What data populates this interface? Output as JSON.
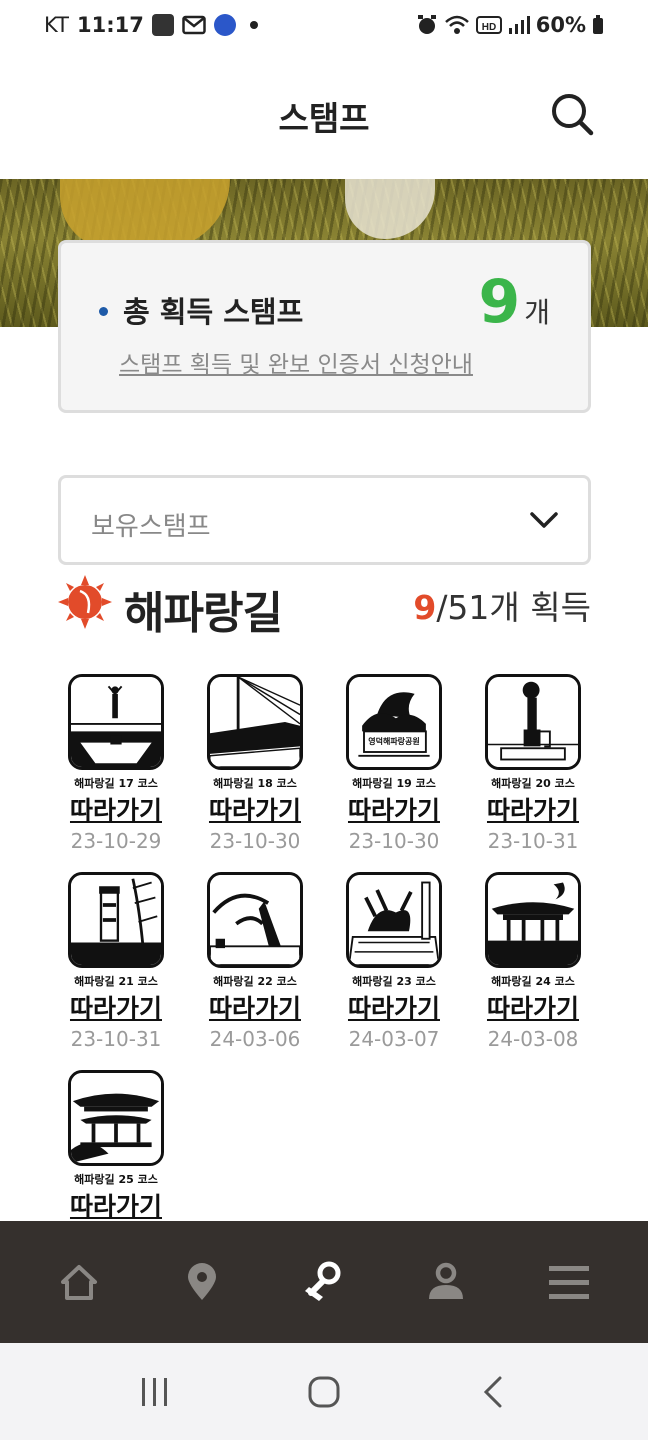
{
  "status_bar": {
    "carrier": "KT",
    "time": "11:17",
    "battery": "60%",
    "icons": [
      "pay-icon",
      "mail-icon",
      "ediya-icon",
      "dot-icon",
      "alarm-icon",
      "wifi-icon",
      "hd-icon",
      "signal-icon",
      "battery-icon"
    ]
  },
  "header": {
    "title": "스탬프",
    "search_icon": "search-icon"
  },
  "summary": {
    "label": "총 획득 스탬프",
    "count": "9",
    "unit": "개",
    "link": "스탬프 획득 및 완보 인증서 신청안내",
    "accent": "#3bb54a"
  },
  "filter": {
    "selected": "보유스탬프"
  },
  "course": {
    "name": "해파랑길",
    "acquired": "9",
    "total_text": "/51개 획득",
    "accent": "#e24b2a"
  },
  "stamps": [
    {
      "caption": "해파랑길 17 코스",
      "action": "따라가기",
      "date": "23-10-29"
    },
    {
      "caption": "해파랑길 18 코스",
      "action": "따라가기",
      "date": "23-10-30"
    },
    {
      "caption": "해파랑길 19 코스",
      "action": "따라가기",
      "date": "23-10-30",
      "badge": "영덕해파랑공원"
    },
    {
      "caption": "해파랑길 20 코스",
      "action": "따라가기",
      "date": "23-10-31"
    },
    {
      "caption": "해파랑길 21 코스",
      "action": "따라가기",
      "date": "23-10-31"
    },
    {
      "caption": "해파랑길 22 코스",
      "action": "따라가기",
      "date": "24-03-06"
    },
    {
      "caption": "해파랑길 23 코스",
      "action": "따라가기",
      "date": "24-03-07"
    },
    {
      "caption": "해파랑길 24 코스",
      "action": "따라가기",
      "date": "24-03-08"
    },
    {
      "caption": "해파랑길 25 코스",
      "action": "따라가기",
      "date": ""
    }
  ],
  "bottom_nav": [
    "home-icon",
    "location-icon",
    "stamp-icon",
    "profile-icon",
    "menu-icon"
  ],
  "system_nav": [
    "recents-icon",
    "home-circle-icon",
    "back-icon"
  ]
}
